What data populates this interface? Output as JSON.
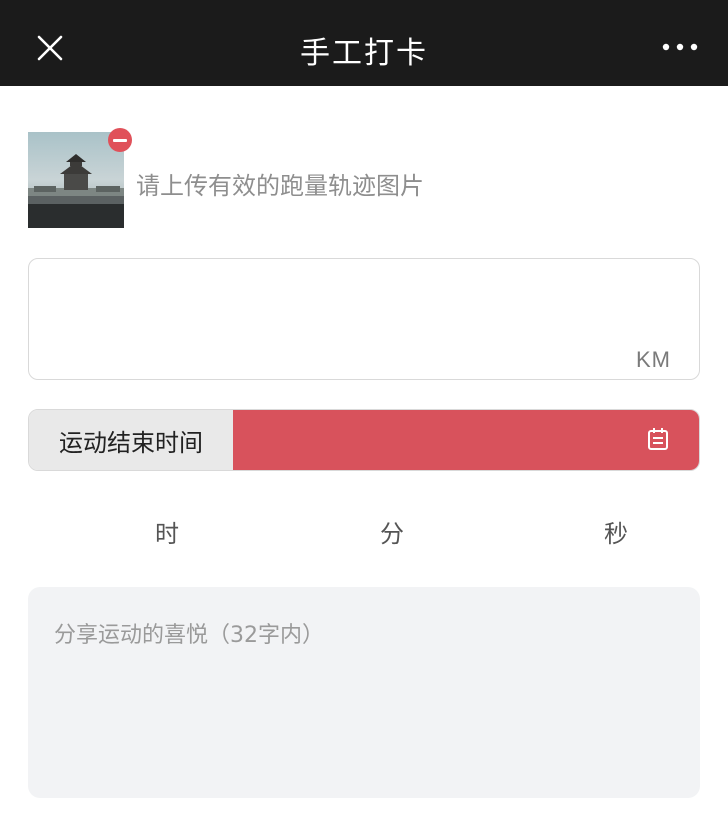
{
  "header": {
    "title": "手工打卡",
    "close_icon": "close-icon",
    "more_icon": "more-icon"
  },
  "upload": {
    "hint": "请上传有效的跑量轨迹图片",
    "remove_icon": "remove-icon"
  },
  "distance": {
    "value": "",
    "unit": "KM"
  },
  "end_time": {
    "label": "运动结束时间",
    "icon": "calendar-icon"
  },
  "duration": {
    "hour_label": "时",
    "minute_label": "分",
    "second_label": "秒"
  },
  "share": {
    "placeholder": "分享运动的喜悦（32字内）",
    "value": ""
  },
  "colors": {
    "topbar": "#1b1b1b",
    "accent": "#d8525c",
    "remove_badge": "#e0515a",
    "share_bg": "#f2f3f5"
  }
}
